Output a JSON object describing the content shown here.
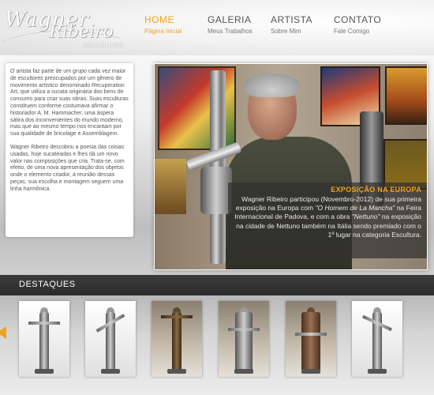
{
  "brand": {
    "script_line1": "Wagner",
    "script_line2": "Ribeiro",
    "subtitle": "esculturas"
  },
  "nav": [
    {
      "title": "HOME",
      "subtitle": "Página Inicial",
      "active": true
    },
    {
      "title": "GALERIA",
      "subtitle": "Meus Trabalhos",
      "active": false
    },
    {
      "title": "ARTISTA",
      "subtitle": "Sobre Mim",
      "active": false
    },
    {
      "title": "CONTATO",
      "subtitle": "Fale Comigo",
      "active": false
    }
  ],
  "intro": {
    "paragraph1": "O artista faz parte de um grupo cada vez maior de escultores preocupados por um gênero de movimento artístico denominado Recuperation Art, que utiliza a sucata originária dos bens de consumo para criar suas obras. Suas esculturas constituem conforme costumava afirmar o historiador A. M. Hammacher, uma áspera sátira dos inconvenientes do mundo moderno, mas que ao mesmo tempo nos encantam por sua qualidade de bricolage e Assemblagem.",
    "paragraph2": "Wagner Ribeiro descobriu a poesia das coisas usadas, hoje sucateadas e lhes dá um novo valor nas composições que cria. Trata-se, com efeito, de uma nova apresentação dos objetos onde o elemento criador, a reunião dessas peças, sua escolha e montagem seguem uma linha harmônica."
  },
  "feature": {
    "title": "EXPOSIÇÃO NA EUROPA",
    "text_a": "Wagner Ribeiro participou (Novembro-2012) de sua primeira exposição na Europa com ",
    "work1": "\"O Homem de La Mancha\"",
    "text_b": " na Feira Internacional de Padova, e com a obra ",
    "work2": "\"Nettuno\"",
    "text_c": " na exposição na cidade de Nettuno também na Itália sendo premiado com o 1º lugar na categoria Escultura."
  },
  "destaques": {
    "label": "DESTAQUES",
    "thumbs": [
      {
        "icon": "sculpture-thumbnail"
      },
      {
        "icon": "sculpture-thumbnail"
      },
      {
        "icon": "sculpture-thumbnail"
      },
      {
        "icon": "sculpture-thumbnail"
      },
      {
        "icon": "sculpture-thumbnail"
      },
      {
        "icon": "sculpture-thumbnail"
      }
    ]
  },
  "colors": {
    "accent": "#f2a31b",
    "dark_bar": "#333333"
  }
}
